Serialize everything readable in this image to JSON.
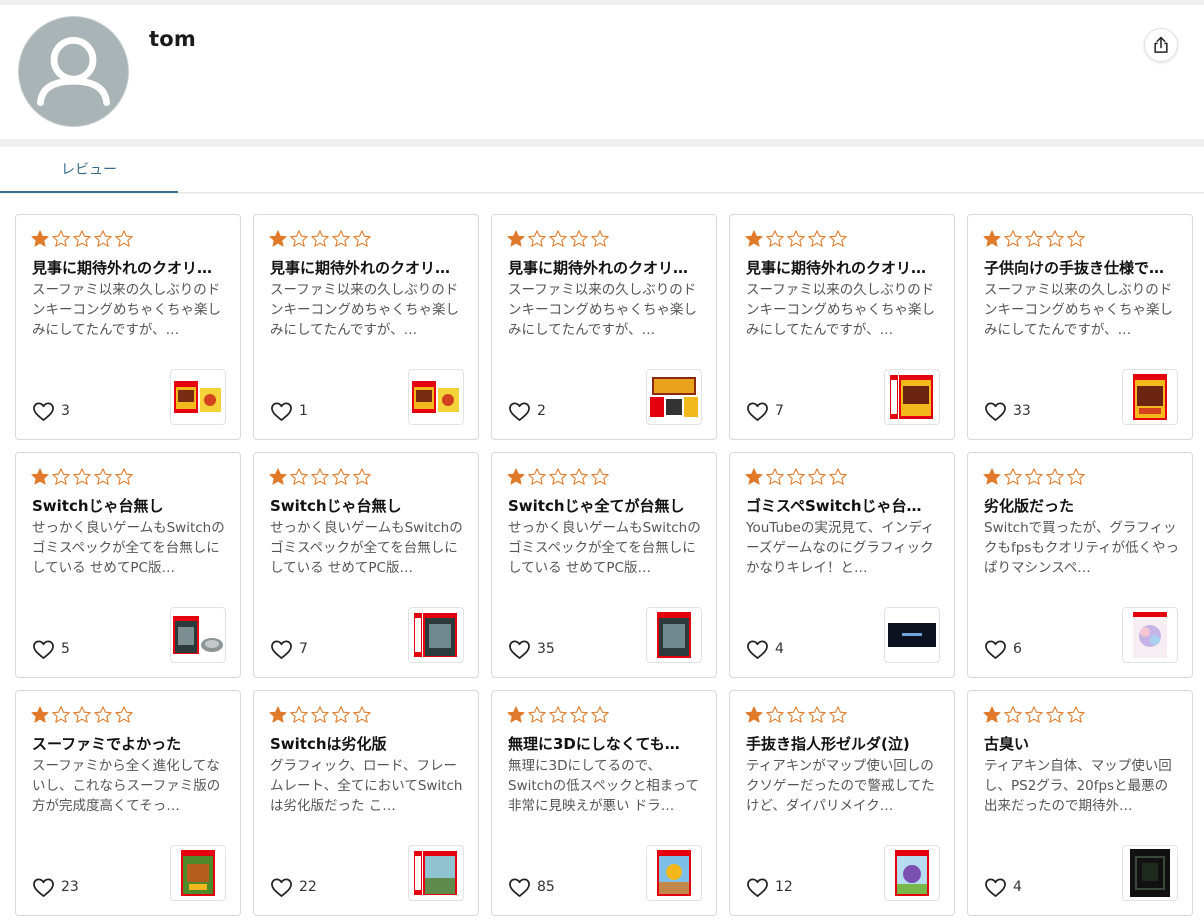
{
  "profile": {
    "username": "tom",
    "avatar_icon": "person-silhouette-icon",
    "share_icon": "share-icon"
  },
  "tabs": [
    {
      "label": "レビュー",
      "active": true
    }
  ],
  "colors": {
    "accent": "#3a6e8c",
    "star": "#e07a2a",
    "avatar_bg": "#a9b4b6"
  },
  "reviews": [
    {
      "rating": 1,
      "title": "見事に期待外れのクオリ…",
      "body": "スーファミ以来の久しぶりのドンキーコングめちゃくちゃ楽しみにしてたんですが、…",
      "likes": "3",
      "thumb": "red-yellow-bundle"
    },
    {
      "rating": 1,
      "title": "見事に期待外れのクオリ…",
      "body": "スーファミ以来の久しぶりのドンキーコングめちゃくちゃ楽しみにしてたんですが、…",
      "likes": "1",
      "thumb": "red-yellow-bundle"
    },
    {
      "rating": 1,
      "title": "見事に期待外れのクオリ…",
      "body": "スーファミ以来の久しぶりのドンキーコングめちゃくちゃ楽しみにしてたんですが、…",
      "likes": "2",
      "thumb": "console-bundle"
    },
    {
      "rating": 1,
      "title": "見事に期待外れのクオリ…",
      "body": "スーファミ以来の久しぶりのドンキーコングめちゃくちゃ楽しみにしてたんですが、…",
      "likes": "7",
      "thumb": "red-case-bonus"
    },
    {
      "rating": 1,
      "title": "子供向けの手抜き仕様で…",
      "body": "スーファミ以来の久しぶりのドンキーコングめちゃくちゃ楽しみにしてたんですが、…",
      "likes": "33",
      "thumb": "red-case"
    },
    {
      "rating": 1,
      "title": "Switchじゃ台無し",
      "body": "せっかく良いゲームもSwitchのゴミスペックが全てを台無しにしている せめてPC版…",
      "likes": "5",
      "thumb": "dark-case-bundle"
    },
    {
      "rating": 1,
      "title": "Switchじゃ台無し",
      "body": "せっかく良いゲームもSwitchのゴミスペックが全てを台無しにしている せめてPC版…",
      "likes": "7",
      "thumb": "dark-case-bonus"
    },
    {
      "rating": 1,
      "title": "Switchじゃ全てが台無し",
      "body": "せっかく良いゲームもSwitchのゴミスペックが全てを台無しにしている せめてPC版…",
      "likes": "35",
      "thumb": "dark-case"
    },
    {
      "rating": 1,
      "title": "ゴミスペSwitchじゃ台…",
      "body": "YouTubeの実況見て、インディーズゲームなのにグラフィックかなりキレイ！と…",
      "likes": "4",
      "thumb": "dark-banner"
    },
    {
      "rating": 1,
      "title": "劣化版だった",
      "body": "Switchで買ったが、グラフィックもfpsもクオリティが低くやっぱりマシンスペ…",
      "likes": "6",
      "thumb": "pastel-case"
    },
    {
      "rating": 1,
      "title": "スーファミでよかった",
      "body": "スーファミから全く進化してないし、これならスーファミ版の方が完成度高くてそっ…",
      "likes": "23",
      "thumb": "green-case"
    },
    {
      "rating": 1,
      "title": "Switchは劣化版",
      "body": "グラフィック、ロード、フレームレート、全てにおいてSwitchは劣化版だった こ…",
      "likes": "22",
      "thumb": "landscape-case-bonus"
    },
    {
      "rating": 1,
      "title": "無理に3Dにしなくても…",
      "body": "無理に3Dにしてるので、Switchの低スペックと相まって非常に見映えが悪い ドラ…",
      "likes": "85",
      "thumb": "sky-case"
    },
    {
      "rating": 1,
      "title": "手抜き指人形ゼルダ(泣)",
      "body": "ティアキンがマップ使い回しのクソゲーだったので警戒してたけど、ダイパリメイク…",
      "likes": "12",
      "thumb": "zelda-case"
    },
    {
      "rating": 1,
      "title": "古臭い",
      "body": "ティアキン自体、マップ使い回し、PS2グラ、20fpsと最悪の出来だったので期待外…",
      "likes": "4",
      "thumb": "black-box"
    }
  ]
}
